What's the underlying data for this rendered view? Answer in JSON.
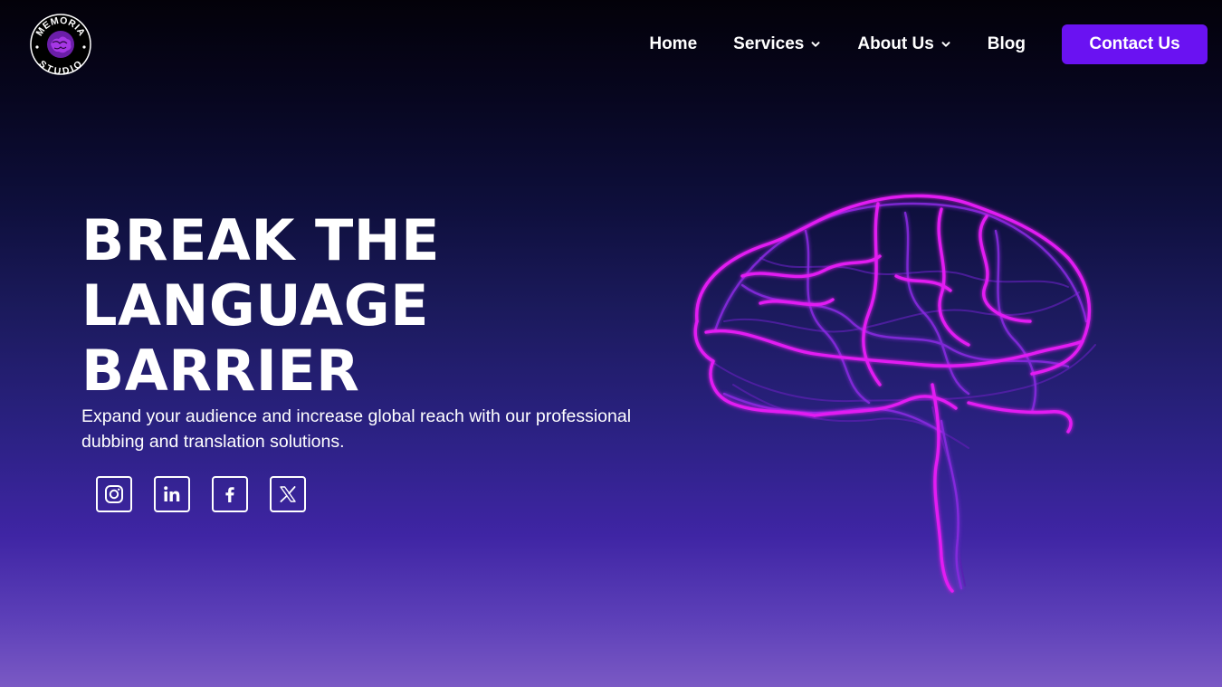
{
  "logo": {
    "top_text": "MEMORIA",
    "bottom_text": "STUDIO"
  },
  "nav": {
    "home": "Home",
    "services": "Services",
    "about": "About Us",
    "blog": "Blog",
    "contact": "Contact Us"
  },
  "hero": {
    "title_line1": "BREAK THE",
    "title_line2": "LANGUAGE",
    "title_line3": "BARRIER",
    "subtitle": "Expand your audience and increase global reach with our professional dubbing and translation solutions."
  },
  "socials": [
    {
      "icon": "instagram-icon"
    },
    {
      "icon": "linkedin-icon"
    },
    {
      "icon": "facebook-icon"
    },
    {
      "icon": "x-icon"
    }
  ],
  "colors": {
    "accent": "#6a12f2",
    "brain_primary": "#e21df2",
    "brain_secondary": "#8a2be2",
    "background_top": "#030109",
    "background_bottom": "#7a59c4"
  }
}
